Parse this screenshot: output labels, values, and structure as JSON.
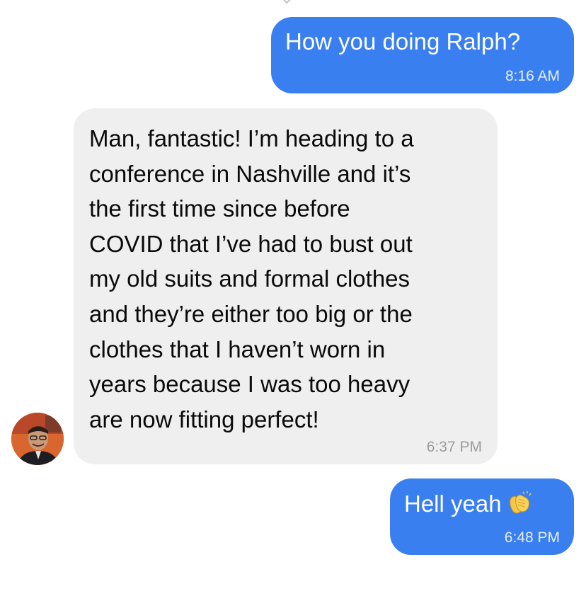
{
  "conversation": {
    "messages": [
      {
        "direction": "outgoing",
        "text": "How you doing Ralph?",
        "time": "8:16 AM"
      },
      {
        "direction": "incoming",
        "text_lines": [
          "Man, fantastic! I’m heading to a",
          "conference in Nashville and it’s",
          "the first time since before",
          "COVID that I’ve had to bust out",
          "my old suits and formal clothes",
          "and they’re either too big or the",
          "clothes that I haven’t worn in",
          "years because I was too heavy",
          "are now fitting perfect!"
        ],
        "time": "6:37 PM"
      },
      {
        "direction": "outgoing",
        "text": "Hell yeah",
        "emoji": "clapping-hands-icon",
        "time": "6:48 PM"
      }
    ]
  },
  "colors": {
    "outgoing_bubble": "#3a7ff0",
    "incoming_bubble": "#efefef",
    "outgoing_text": "#ffffff",
    "incoming_text": "#0a0a0a",
    "incoming_timestamp": "#9c9c9c"
  }
}
